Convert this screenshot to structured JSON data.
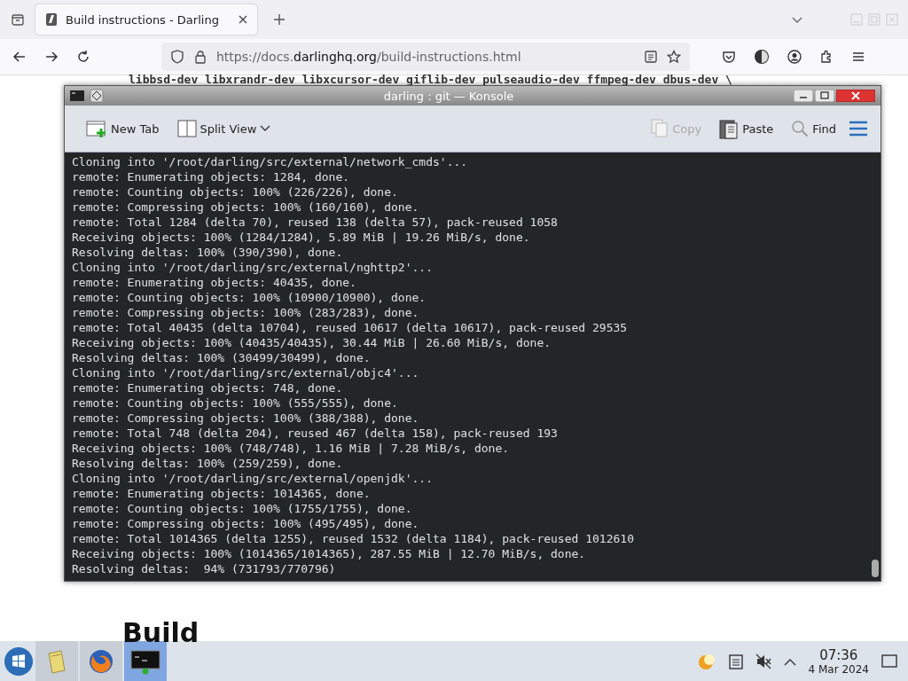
{
  "browser": {
    "tab_title": "Build instructions - Darling",
    "url_prefix": "https://docs.",
    "url_domain": "darlinghq.org",
    "url_path": "/build-instructions.html"
  },
  "page": {
    "code_line": "libbsd-dev libxrandr-dev libxcursor-dev giflib-dev pulseaudio-dev ffmpeg-dev dbus-dev \\",
    "heading": "Build"
  },
  "konsole": {
    "title": "darling : git — Konsole",
    "toolbar": [
      {
        "kind": "newtab",
        "label": "New Tab",
        "disabled": false
      },
      {
        "kind": "split",
        "label": "Split View",
        "disabled": false
      },
      {
        "kind": "copy",
        "label": "Copy",
        "disabled": true
      },
      {
        "kind": "paste",
        "label": "Paste",
        "disabled": false
      },
      {
        "kind": "find",
        "label": "Find",
        "disabled": false
      }
    ],
    "lines": [
      "Cloning into '/root/darling/src/external/network_cmds'...",
      "remote: Enumerating objects: 1284, done.",
      "remote: Counting objects: 100% (226/226), done.",
      "remote: Compressing objects: 100% (160/160), done.",
      "remote: Total 1284 (delta 70), reused 138 (delta 57), pack-reused 1058",
      "Receiving objects: 100% (1284/1284), 5.89 MiB | 19.26 MiB/s, done.",
      "Resolving deltas: 100% (390/390), done.",
      "Cloning into '/root/darling/src/external/nghttp2'...",
      "remote: Enumerating objects: 40435, done.",
      "remote: Counting objects: 100% (10900/10900), done.",
      "remote: Compressing objects: 100% (283/283), done.",
      "remote: Total 40435 (delta 10704), reused 10617 (delta 10617), pack-reused 29535",
      "Receiving objects: 100% (40435/40435), 30.44 MiB | 26.60 MiB/s, done.",
      "Resolving deltas: 100% (30499/30499), done.",
      "Cloning into '/root/darling/src/external/objc4'...",
      "remote: Enumerating objects: 748, done.",
      "remote: Counting objects: 100% (555/555), done.",
      "remote: Compressing objects: 100% (388/388), done.",
      "remote: Total 748 (delta 204), reused 467 (delta 158), pack-reused 193",
      "Receiving objects: 100% (748/748), 1.16 MiB | 7.28 MiB/s, done.",
      "Resolving deltas: 100% (259/259), done.",
      "Cloning into '/root/darling/src/external/openjdk'...",
      "remote: Enumerating objects: 1014365, done.",
      "remote: Counting objects: 100% (1755/1755), done.",
      "remote: Compressing objects: 100% (495/495), done.",
      "remote: Total 1014365 (delta 1255), reused 1532 (delta 1184), pack-reused 1012610",
      "Receiving objects: 100% (1014365/1014365), 287.55 MiB | 12.70 MiB/s, done.",
      "Resolving deltas:  94% (731793/770796)"
    ]
  },
  "taskbar": {
    "apps": [
      {
        "kind": "files",
        "selected": false
      },
      {
        "kind": "firefox",
        "selected": false
      },
      {
        "kind": "terminal",
        "selected": true
      }
    ],
    "time": "07:36",
    "date": "4 Mar 2024"
  }
}
